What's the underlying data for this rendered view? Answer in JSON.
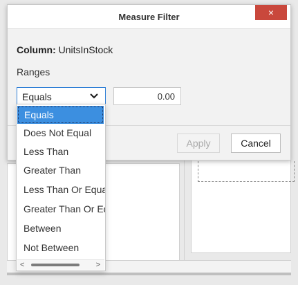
{
  "dialog": {
    "title": "Measure Filter",
    "close_icon": "×",
    "column_label": "Column:",
    "column_name": "UnitsInStock",
    "ranges_label": "Ranges",
    "operator_select": {
      "value": "Equals"
    },
    "value_input": {
      "value": "0.00"
    },
    "apply_label": "Apply",
    "cancel_label": "Cancel"
  },
  "dropdown": {
    "options": [
      "Equals",
      "Does Not Equal",
      "Less Than",
      "Greater Than",
      "Less Than Or Equal T",
      "Greater Than Or Equa",
      "Between",
      "Not Between"
    ],
    "selected_index": 0,
    "scroll_left": "<",
    "scroll_right": ">"
  },
  "colors": {
    "accent": "#3c8fe0",
    "close": "#c9483c"
  }
}
